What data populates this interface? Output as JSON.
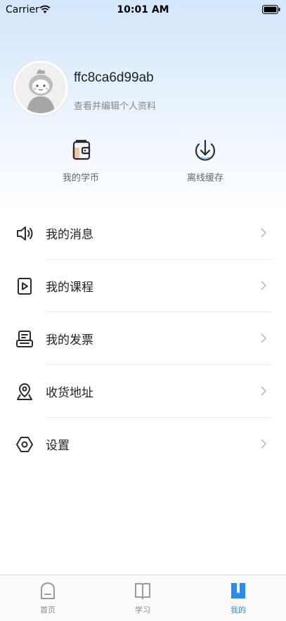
{
  "status_bar": {
    "carrier": "Carrier",
    "time": "10:01 AM"
  },
  "profile": {
    "username": "ffc8ca6d99ab",
    "subtitle": "查看并编辑个人资料",
    "avatar_icon": "default-avatar-icon"
  },
  "quick_actions": [
    {
      "label": "我的学币",
      "icon": "wallet-icon"
    },
    {
      "label": "离线缓存",
      "icon": "download-icon"
    }
  ],
  "menu": [
    {
      "label": "我的消息",
      "icon": "speaker-icon"
    },
    {
      "label": "我的课程",
      "icon": "course-play-icon"
    },
    {
      "label": "我的发票",
      "icon": "invoice-icon"
    },
    {
      "label": "收货地址",
      "icon": "location-icon"
    },
    {
      "label": "设置",
      "icon": "settings-hex-icon"
    }
  ],
  "tabbar": [
    {
      "label": "首页",
      "icon": "home-icon",
      "active": false
    },
    {
      "label": "学习",
      "icon": "book-icon",
      "active": false
    },
    {
      "label": "我的",
      "icon": "bookmark-icon",
      "active": true
    }
  ],
  "colors": {
    "accent": "#2a8cf0",
    "header_gradient_top": "#d4e7fb",
    "text_primary": "#222222",
    "text_secondary": "#888888",
    "divider": "#eeeeee",
    "coin_highlight": "#f6b78a"
  }
}
